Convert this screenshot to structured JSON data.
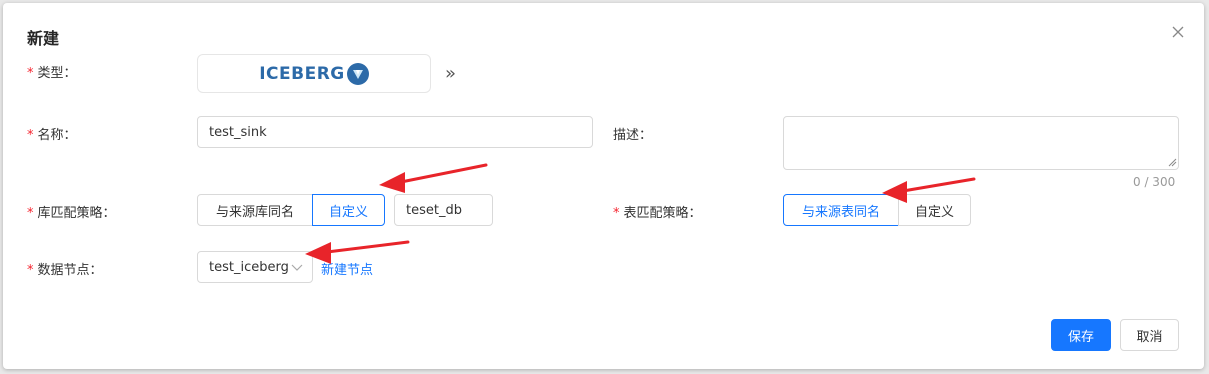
{
  "dialog": {
    "title": "新建",
    "required_mark": "*",
    "type": {
      "label": "类型：",
      "value": "ICEBERG",
      "switch_icon": "double-chevron-right-icon"
    },
    "name": {
      "label": "名称：",
      "value": "test_sink"
    },
    "description": {
      "label": "描述：",
      "value": "",
      "counter": "0 / 300"
    },
    "db_strategy": {
      "label": "库匹配策略：",
      "options": [
        "与来源库同名",
        "自定义"
      ],
      "selected": "自定义",
      "custom_value": "teset_db"
    },
    "table_strategy": {
      "label": "表匹配策略：",
      "options": [
        "与来源表同名",
        "自定义"
      ],
      "selected": "与来源表同名"
    },
    "data_node": {
      "label": "数据节点：",
      "value": "test_iceberg",
      "new_link": "新建节点"
    },
    "footer": {
      "save": "保存",
      "cancel": "取消"
    }
  },
  "colors": {
    "primary": "#1677ff",
    "required": "#f5222d",
    "arrow": "#e8242a",
    "iceberg": "#2c6aa8"
  }
}
